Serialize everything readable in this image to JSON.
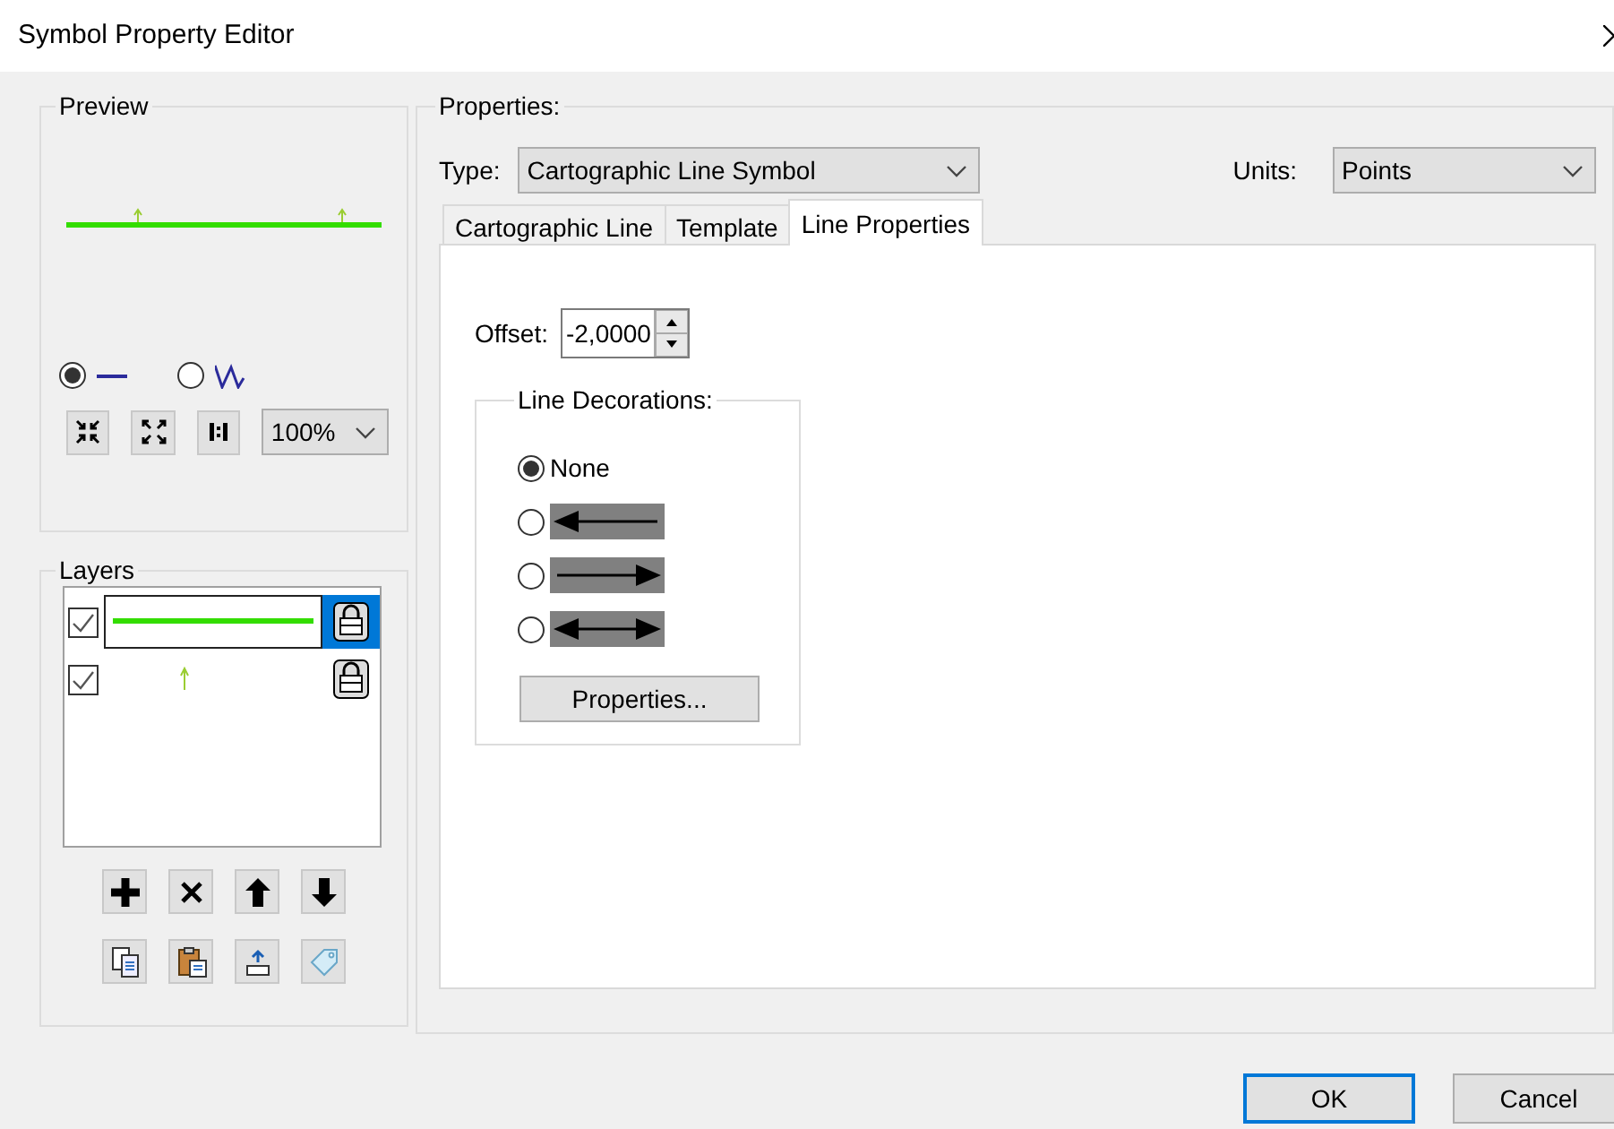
{
  "window": {
    "title": "Symbol Property Editor"
  },
  "preview": {
    "title": "Preview",
    "view_modes": [
      {
        "kind": "line",
        "selected": true
      },
      {
        "kind": "zigzag",
        "selected": false
      }
    ],
    "zoom": "100%"
  },
  "layers": {
    "title": "Layers",
    "items": [
      {
        "kind": "line",
        "checked": true,
        "selected": true
      },
      {
        "kind": "arrow",
        "checked": true,
        "selected": false
      }
    ]
  },
  "properties": {
    "title": "Properties:",
    "type_label": "Type:",
    "type_value": "Cartographic Line Symbol",
    "units_label": "Units:",
    "units_value": "Points",
    "tabs": [
      {
        "label": "Cartographic Line",
        "selected": false
      },
      {
        "label": "Template",
        "selected": false
      },
      {
        "label": "Line Properties",
        "selected": true
      }
    ],
    "offset_label": "Offset:",
    "offset_value": "-2,0000",
    "decorations": {
      "title": "Line Decorations:",
      "options": [
        {
          "kind": "none",
          "label": "None",
          "selected": true
        },
        {
          "kind": "arrow-start",
          "selected": false
        },
        {
          "kind": "arrow-end",
          "selected": false
        },
        {
          "kind": "arrow-both",
          "selected": false
        }
      ],
      "button": "Properties..."
    }
  },
  "buttons": [
    {
      "label": "OK",
      "default": true
    },
    {
      "label": "Cancel",
      "default": false
    }
  ]
}
